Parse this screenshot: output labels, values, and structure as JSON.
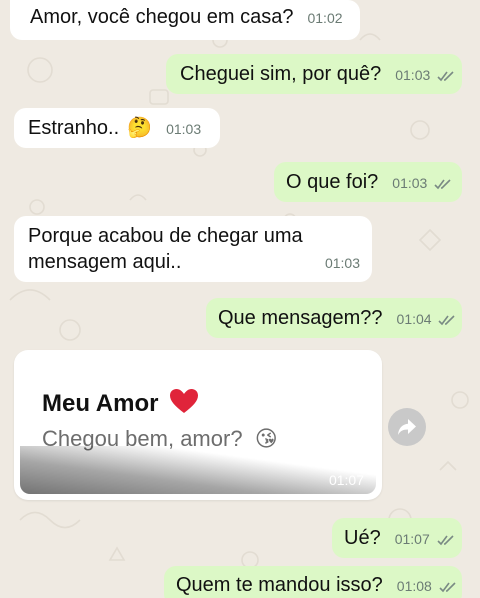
{
  "messages": [
    {
      "text": "Amor, você chegou em casa?",
      "time": "01:02"
    },
    {
      "text": "Cheguei sim, por quê?",
      "time": "01:03"
    },
    {
      "text": "Estranho..",
      "emoji": "🤔",
      "time": "01:03"
    },
    {
      "text": "O que foi?",
      "time": "01:03"
    },
    {
      "text_line1": "Porque acabou de chegar uma",
      "text_line2": "mensagem aqui..",
      "time": "01:03"
    },
    {
      "text": "Que mensagem??",
      "time": "01:04"
    },
    {
      "notif_title": "Meu Amor",
      "notif_title_emoji": "❤️",
      "notif_body": "Chegou bem, amor?",
      "notif_body_emoji": "😘",
      "time": "01:07"
    },
    {
      "text": "Ué?",
      "time": "01:07"
    },
    {
      "text": "Quem te mandou isso?",
      "time": "01:08"
    }
  ],
  "icons": {
    "read_receipt": "double-check-icon",
    "forward": "forward-arrow-icon"
  },
  "colors": {
    "background": "#efeae2",
    "incoming_bubble": "#ffffff",
    "outgoing_bubble": "#dcf8c6",
    "heart": "#e0243a"
  }
}
